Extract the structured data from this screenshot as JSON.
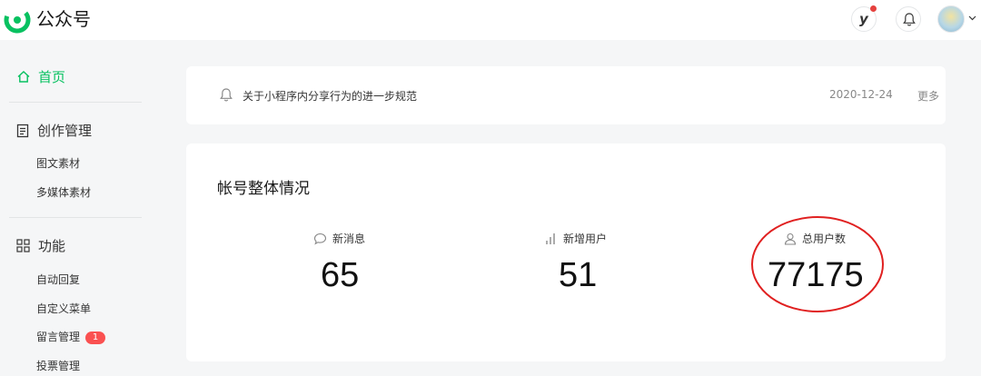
{
  "header": {
    "app_title": "公众号",
    "logo_icon": "wechat-official-accounts-logo",
    "y_label": "y",
    "accent": "#07c160"
  },
  "sidebar": {
    "home_label": "首页",
    "sections": [
      {
        "label": "创作管理",
        "icon": "document-icon",
        "items": [
          "图文素材",
          "多媒体素材"
        ]
      },
      {
        "label": "功能",
        "icon": "grid-icon",
        "items": [
          "自动回复",
          "自定义菜单",
          "留言管理",
          "投票管理"
        ]
      }
    ],
    "message_badge": "1"
  },
  "notice": {
    "text": "关于小程序内分享行为的进一步规范",
    "date": "2020-12-24",
    "more": "更多"
  },
  "stats": {
    "title": "帐号整体情况",
    "items": [
      {
        "label": "新消息",
        "value": "65",
        "icon": "chat-bubble-icon"
      },
      {
        "label": "新增用户",
        "value": "51",
        "icon": "bar-chart-icon"
      },
      {
        "label": "总用户数",
        "value": "77175",
        "icon": "user-icon"
      }
    ],
    "annotation_color": "#e02020"
  }
}
